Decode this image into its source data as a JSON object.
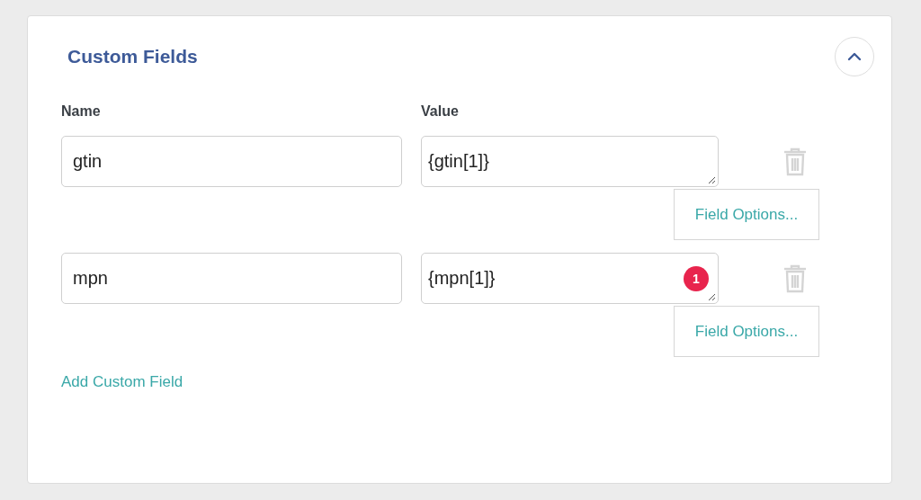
{
  "panel": {
    "title": "Custom Fields",
    "expanded": true
  },
  "columns": {
    "name": "Name",
    "value": "Value"
  },
  "fields": [
    {
      "name": "gtin",
      "value": "{gtin[1]}",
      "options_button": "Field Options..."
    },
    {
      "name": "mpn",
      "value": "{mpn[1]}",
      "badge": "1",
      "options_button": "Field Options..."
    }
  ],
  "add_link": "Add Custom Field"
}
